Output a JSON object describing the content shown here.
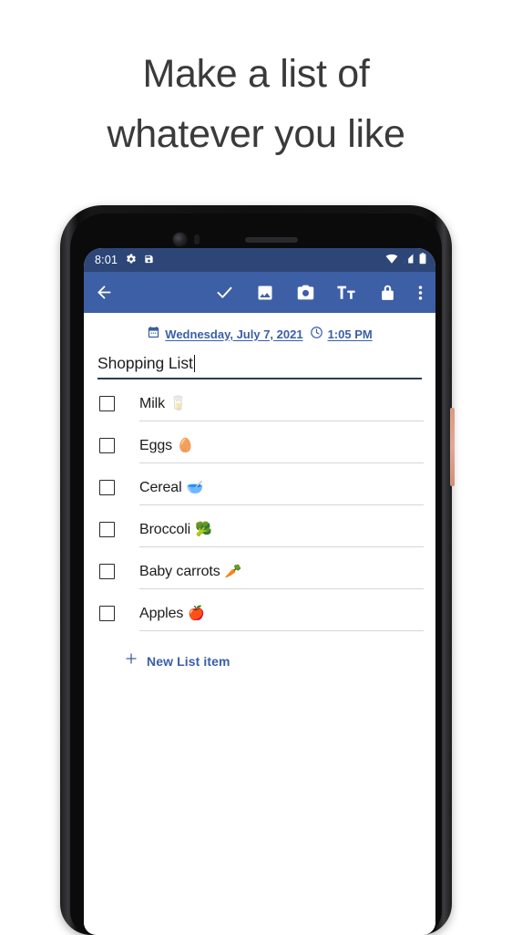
{
  "headline": "Make a list of\nwhatever you like",
  "colors": {
    "toolbar_blue": "#3d5fa6",
    "status_bar_blue": "#2d4677",
    "accent_blue": "#3a5fa8",
    "page_background": "#ffffff",
    "power_button": "#d99b86"
  },
  "phone": {
    "status_bar": {
      "time": "8:01",
      "left_icons": [
        "gear-icon",
        "save-clipboard-icon"
      ],
      "right_icons": [
        "wifi-icon",
        "cellular-signal-icon",
        "battery-icon"
      ]
    },
    "toolbar": {
      "back_label": "Back",
      "actions": [
        {
          "name": "check-icon",
          "label": "Save"
        },
        {
          "name": "image-icon",
          "label": "Insert image"
        },
        {
          "name": "camera-icon",
          "label": "Camera"
        },
        {
          "name": "text-format-icon",
          "label": "Tt"
        },
        {
          "name": "lock-icon",
          "label": "Lock"
        },
        {
          "name": "overflow-menu-icon",
          "label": "More options"
        }
      ]
    },
    "note": {
      "date": "Wednesday, July 7, 2021",
      "time": "1:05 PM",
      "title": "Shopping List",
      "items": [
        {
          "text": "Milk",
          "emoji": "🥛",
          "checked": false
        },
        {
          "text": "Eggs",
          "emoji": "🥚",
          "checked": false
        },
        {
          "text": "Cereal",
          "emoji": "🥣",
          "checked": false
        },
        {
          "text": "Broccoli",
          "emoji": "🥦",
          "checked": false
        },
        {
          "text": "Baby carrots",
          "emoji": "🥕",
          "checked": false
        },
        {
          "text": "Apples",
          "emoji": "🍎",
          "checked": false
        }
      ],
      "new_item_label": "New List item"
    }
  }
}
